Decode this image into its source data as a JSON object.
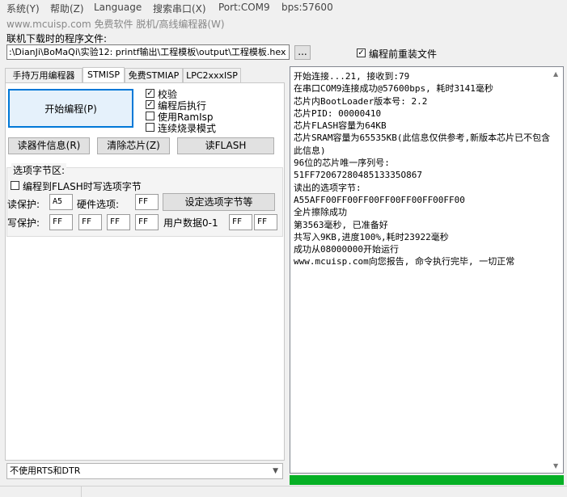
{
  "menu": [
    "系统(Y)",
    "帮助(Z)",
    "Language",
    "搜索串口(X)",
    "Port:COM9",
    "bps:57600"
  ],
  "subtitle": "www.mcuisp.com 免费软件 脱机/高线编程器(W)",
  "file": {
    "label": "联机下载时的程序文件:",
    "path": ":\\DianJi\\BoMaQi\\实验12: printf输出\\工程模板\\output\\工程模板.hex",
    "browse": "...",
    "reload_label": "编程前重装文件",
    "reload_checked": true
  },
  "tabs": [
    "手持万用编程器",
    "STMISP",
    "免费STMIAP",
    "LPC2xxxISP"
  ],
  "active_tab": 1,
  "stmisp": {
    "start_button": "开始编程(P)",
    "options": [
      {
        "label": "校验",
        "checked": true
      },
      {
        "label": "编程后执行",
        "checked": true
      },
      {
        "label": "使用RamIsp",
        "checked": false
      },
      {
        "label": "连续烧录模式",
        "checked": false
      }
    ],
    "read_info_button": "读器件信息(R)",
    "erase_button": "清除芯片(Z)",
    "read_flash_button": "读FLASH",
    "option_bytes": {
      "title": "选项字节区:",
      "write_to_flash_label": "编程到FLASH时写选项字节",
      "write_to_flash_checked": false,
      "read_protect_label": "读保护:",
      "read_protect_value": "A5",
      "hw_option_label": "硬件选项:",
      "hw_option_value": "FF",
      "set_button": "设定选项字节等",
      "write_protect_label": "写保护:",
      "write_protect_values": [
        "FF",
        "FF",
        "FF",
        "FF"
      ],
      "user_data_label": "用户数据0-1",
      "user_data_values": [
        "FF",
        "FF"
      ]
    },
    "rts_dtr_option": "不使用RTS和DTR"
  },
  "log": [
    "开始连接...21, 接收到:79",
    "在串口COM9连接成功@57600bps, 耗时3141毫秒",
    "芯片内BootLoader版本号: 2.2",
    "芯片PID: 00000410",
    "芯片FLASH容量为64KB",
    "芯片SRAM容量为65535KB(此信息仅供参考,新版本芯片已不包含此信息)",
    "96位的芯片唯一序列号:",
    "51FF7206728048513335O867",
    "读出的选项字节:",
    "A55AFF00FF00FF00FF00FF00FF00FF00",
    "全片擦除成功",
    "第3563毫秒, 已准备好",
    "共写入9KB,进度100%,耗时23922毫秒",
    "成功从08000000开始运行",
    "www.mcuisp.com向您报告, 命令执行完毕, 一切正常"
  ],
  "progress_fraction": 1.0,
  "colors": {
    "progress": "#06b025",
    "subtitle": "#888888"
  }
}
